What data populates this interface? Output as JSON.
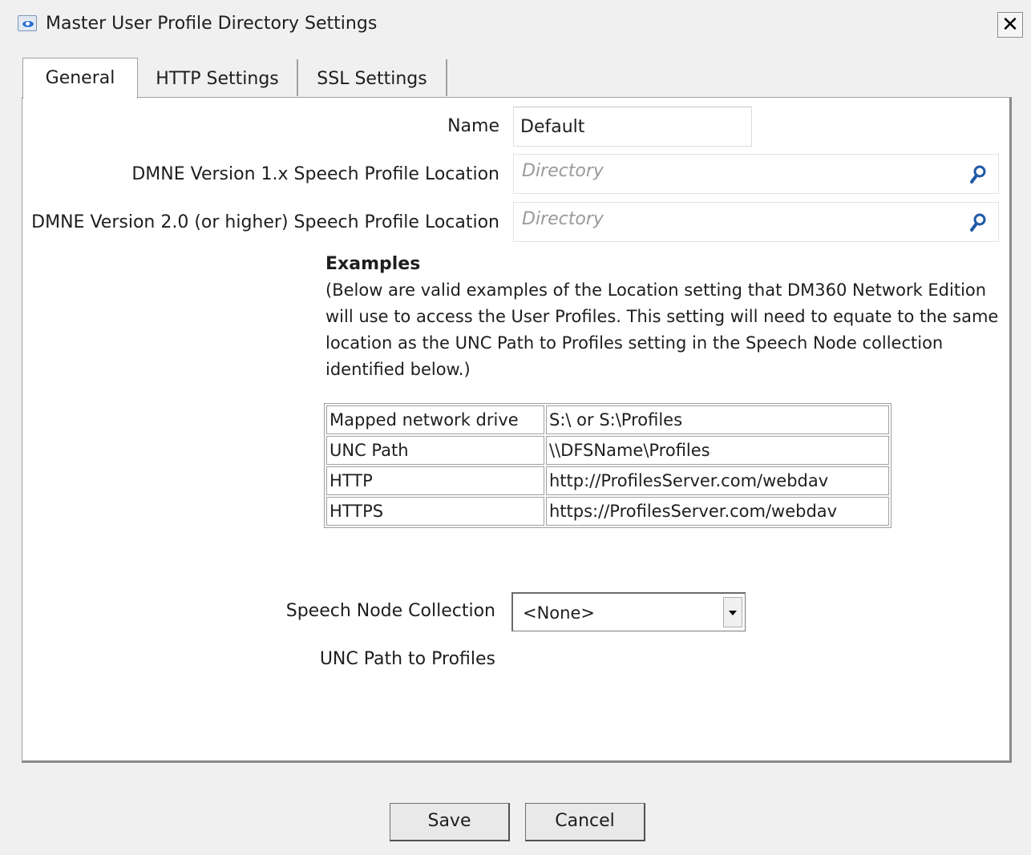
{
  "window": {
    "title": "Master User Profile Directory Settings",
    "close_glyph": "✕"
  },
  "tabs": [
    {
      "label": "General",
      "active": true
    },
    {
      "label": "HTTP Settings",
      "active": false
    },
    {
      "label": "SSL Settings",
      "active": false
    }
  ],
  "general": {
    "name_label": "Name",
    "name_value": "Default",
    "v1_label": "DMNE Version 1.x Speech Profile Location",
    "v1_placeholder": "Directory",
    "v2_label": "DMNE Version 2.0 (or higher) Speech Profile Location",
    "v2_placeholder": "Directory",
    "examples_title": "Examples",
    "examples_text": "(Below are valid examples of the Location setting that DM360 Network Edition will use to access the User Profiles. This setting will need to equate to the same location as the UNC Path to Profiles setting in the Speech Node collection identified below.)",
    "examples_table": [
      [
        "Mapped network drive",
        "S:\\ or S:\\Profiles"
      ],
      [
        "UNC Path",
        "\\\\DFSName\\Profiles"
      ],
      [
        "HTTP",
        "http://ProfilesServer.com/webdav"
      ],
      [
        "HTTPS",
        "https://ProfilesServer.com/webdav"
      ]
    ],
    "speech_node_label": "Speech Node Collection",
    "speech_node_value": "<None>",
    "unc_path_label": "UNC Path to Profiles"
  },
  "buttons": {
    "save": "Save",
    "cancel": "Cancel"
  },
  "icons": {
    "search": "search-icon",
    "dropdown": "chevron-down-icon",
    "app": "app-icon"
  },
  "colors": {
    "window_bg": "#f0f0f0",
    "panel_bg": "#ffffff",
    "search_icon": "#1e5aa8"
  }
}
